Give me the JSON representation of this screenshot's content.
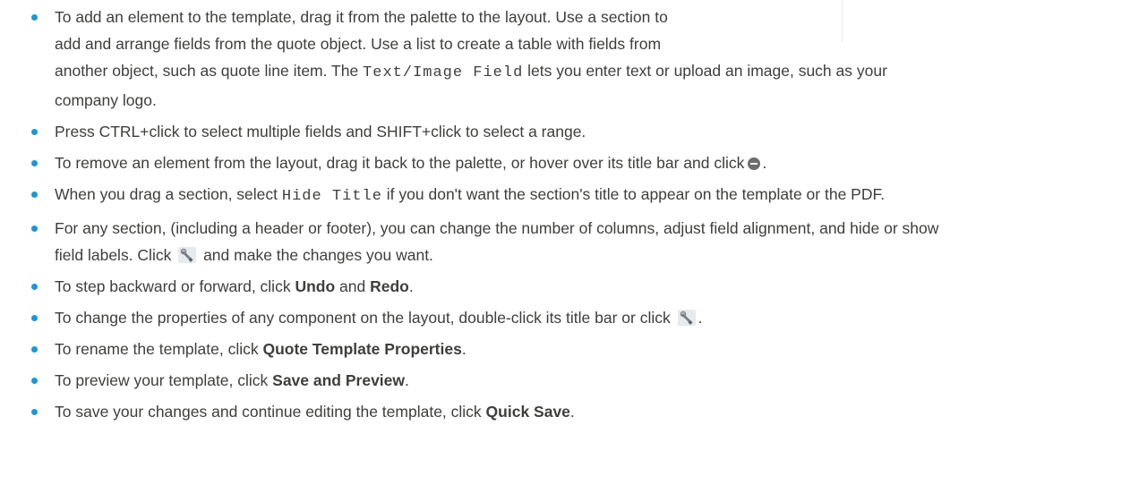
{
  "tips": [
    {
      "a": "To add an element to the template, drag it from the palette to the layout. Use a section to",
      "b": "add and arrange fields from the quote object. Use a list to create a table with fields from",
      "c": "another object, such as quote line item. The ",
      "code": "Text/Image Field",
      "d": " lets you enter text or upload an image, such as your",
      "e": "company logo."
    },
    {
      "text": "Press CTRL+click to select multiple fields and SHIFT+click to select a range."
    },
    {
      "before": "To remove an element from the layout, drag it back to the palette, or hover over its title bar and click",
      "after": ".",
      "icon": "remove-icon"
    },
    {
      "before": "When you drag a section, select ",
      "code": "Hide Title",
      "after": " if you don't want the section's title to appear on the template or the PDF."
    },
    {
      "line1": "For any section, (including a header or footer), you can change the number of columns, adjust field alignment, and hide or show",
      "line2_before": "field labels. Click",
      "line2_after": "and make the changes you want.",
      "icon": "wrench-icon"
    },
    {
      "before": "To step backward or forward, click ",
      "bold1": "Undo",
      "middle": " and ",
      "bold2": "Redo",
      "after": "."
    },
    {
      "before": "To change the properties of any component on the layout, double-click its title bar or click",
      "after": ".",
      "icon": "wrench-icon"
    },
    {
      "before": "To rename the template, click ",
      "bold": "Quote Template Properties",
      "after": "."
    },
    {
      "before": "To preview your template, click ",
      "bold": "Save and Preview",
      "after": "."
    },
    {
      "before": "To save your changes and continue editing the template, click ",
      "bold": "Quick Save",
      "after": "."
    }
  ],
  "colors": {
    "bullet": "#1b96d7",
    "text": "#3e3e3c"
  }
}
